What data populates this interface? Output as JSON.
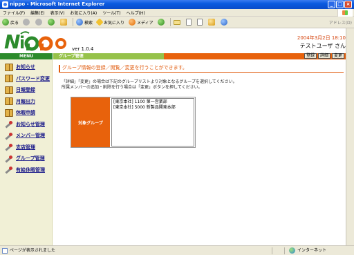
{
  "window": {
    "title": "nippo - Microsoft Internet Explorer"
  },
  "menubar": [
    "ファイル(F)",
    "編集(E)",
    "表示(V)",
    "お気に入り(A)",
    "ツール(T)",
    "ヘルプ(H)"
  ],
  "toolbar": {
    "back": "戻る",
    "search": "検索",
    "favorites": "お気に入り",
    "media": "メディア",
    "address_label": "アドレス(D)"
  },
  "header": {
    "version": "ver 1.0.4",
    "datetime": "2004年3月2日 18:10",
    "username": "テストユーザ さん"
  },
  "sidebar": {
    "title": "MENU",
    "items": [
      {
        "label": "お知らせ",
        "icon": "book-icon"
      },
      {
        "label": "パスワード変更",
        "icon": "book-icon"
      },
      {
        "label": "日報登録",
        "icon": "book-icon"
      },
      {
        "label": "月報出力",
        "icon": "book-icon"
      },
      {
        "label": "休暇申請",
        "icon": "book-icon"
      },
      {
        "label": "お知らせ管理",
        "icon": "tool-icon"
      },
      {
        "label": "メンバー管理",
        "icon": "tool-icon"
      },
      {
        "label": "支店管理",
        "icon": "tool-icon"
      },
      {
        "label": "グループ管理",
        "icon": "tool-icon"
      },
      {
        "label": "有給休暇管理",
        "icon": "tool-icon"
      }
    ]
  },
  "main": {
    "section_title": "グループ管理",
    "buttons": {
      "register": "登録",
      "detail": "詳細",
      "change": "変更"
    },
    "headline": "グループ情報の登録／閲覧／変更を行うことができます。",
    "description": [
      "「詳細」「変更」の場合は下記のグループリストより対象となるグループを選択してください。",
      "所属メンバーの追加・削除を行う場合は「変更」ボタンを押してください。"
    ],
    "group_label": "対象グループ",
    "groups": [
      "[東京本社] 1100 第一営業部",
      "[東京本社] 5000 新製品開発本部"
    ]
  },
  "statusbar": {
    "status": "ページが表示されました",
    "zone": "インターネット"
  },
  "colors": {
    "accent_orange": "#e8620c",
    "menu_green": "#2c8b2c",
    "bar_green": "#96c24a"
  }
}
